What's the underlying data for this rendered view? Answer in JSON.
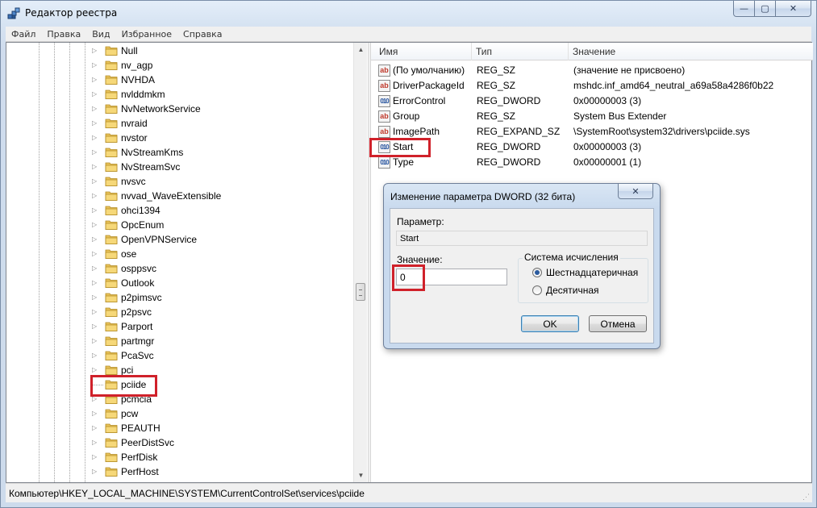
{
  "window": {
    "title": "Редактор реестра",
    "buttons": {
      "minimize": "—",
      "maximize": "▢",
      "close": "✕"
    }
  },
  "menu": [
    "Файл",
    "Правка",
    "Вид",
    "Избранное",
    "Справка"
  ],
  "tree": {
    "items": [
      {
        "label": "Null"
      },
      {
        "label": "nv_agp"
      },
      {
        "label": "NVHDA"
      },
      {
        "label": "nvlddmkm"
      },
      {
        "label": "NvNetworkService"
      },
      {
        "label": "nvraid"
      },
      {
        "label": "nvstor"
      },
      {
        "label": "NvStreamKms"
      },
      {
        "label": "NvStreamSvc"
      },
      {
        "label": "nvsvc"
      },
      {
        "label": "nvvad_WaveExtensible"
      },
      {
        "label": "ohci1394"
      },
      {
        "label": "OpcEnum"
      },
      {
        "label": "OpenVPNService"
      },
      {
        "label": "ose"
      },
      {
        "label": "osppsvc"
      },
      {
        "label": "Outlook"
      },
      {
        "label": "p2pimsvc"
      },
      {
        "label": "p2psvc"
      },
      {
        "label": "Parport"
      },
      {
        "label": "partmgr"
      },
      {
        "label": "PcaSvc"
      },
      {
        "label": "pci"
      },
      {
        "label": "pciide",
        "selected": true
      },
      {
        "label": "pcmcia"
      },
      {
        "label": "pcw"
      },
      {
        "label": "PEAUTH"
      },
      {
        "label": "PeerDistSvc"
      },
      {
        "label": "PerfDisk"
      },
      {
        "label": "PerfHost"
      }
    ]
  },
  "list": {
    "columns": [
      "Имя",
      "Тип",
      "Значение"
    ],
    "rows": [
      {
        "icon": "string-value-icon",
        "icon_text": "ab",
        "name": "(По умолчанию)",
        "type": "REG_SZ",
        "value": "(значение не присвоено)"
      },
      {
        "icon": "string-value-icon",
        "icon_text": "ab",
        "name": "DriverPackageId",
        "type": "REG_SZ",
        "value": "mshdc.inf_amd64_neutral_a69a58a4286f0b22"
      },
      {
        "icon": "dword-value-icon",
        "icon_text": "010",
        "name": "ErrorControl",
        "type": "REG_DWORD",
        "value": "0x00000003 (3)"
      },
      {
        "icon": "string-value-icon",
        "icon_text": "ab",
        "name": "Group",
        "type": "REG_SZ",
        "value": "System Bus Extender"
      },
      {
        "icon": "string-value-icon",
        "icon_text": "ab",
        "name": "ImagePath",
        "type": "REG_EXPAND_SZ",
        "value": "\\SystemRoot\\system32\\drivers\\pciide.sys"
      },
      {
        "icon": "dword-value-icon",
        "icon_text": "010",
        "name": "Start",
        "type": "REG_DWORD",
        "value": "0x00000003 (3)"
      },
      {
        "icon": "dword-value-icon",
        "icon_text": "010",
        "name": "Type",
        "type": "REG_DWORD",
        "value": "0x00000001 (1)"
      }
    ]
  },
  "statusbar": {
    "path": "Компьютер\\HKEY_LOCAL_MACHINE\\SYSTEM\\CurrentControlSet\\services\\pciide"
  },
  "dialog": {
    "title": "Изменение параметра DWORD (32 бита)",
    "close": "✕",
    "param_label": "Параметр:",
    "param_value": "Start",
    "value_label": "Значение:",
    "value": "0",
    "base_title": "Система исчисления",
    "hex_label": "Шестнадцатеричная",
    "dec_label": "Десятичная",
    "selected_base": "hex",
    "ok": "OK",
    "cancel": "Отмена"
  },
  "colors": {
    "highlight": "#d0212a",
    "dword_icon": "#1f4e9c",
    "string_icon": "#c0392b"
  }
}
